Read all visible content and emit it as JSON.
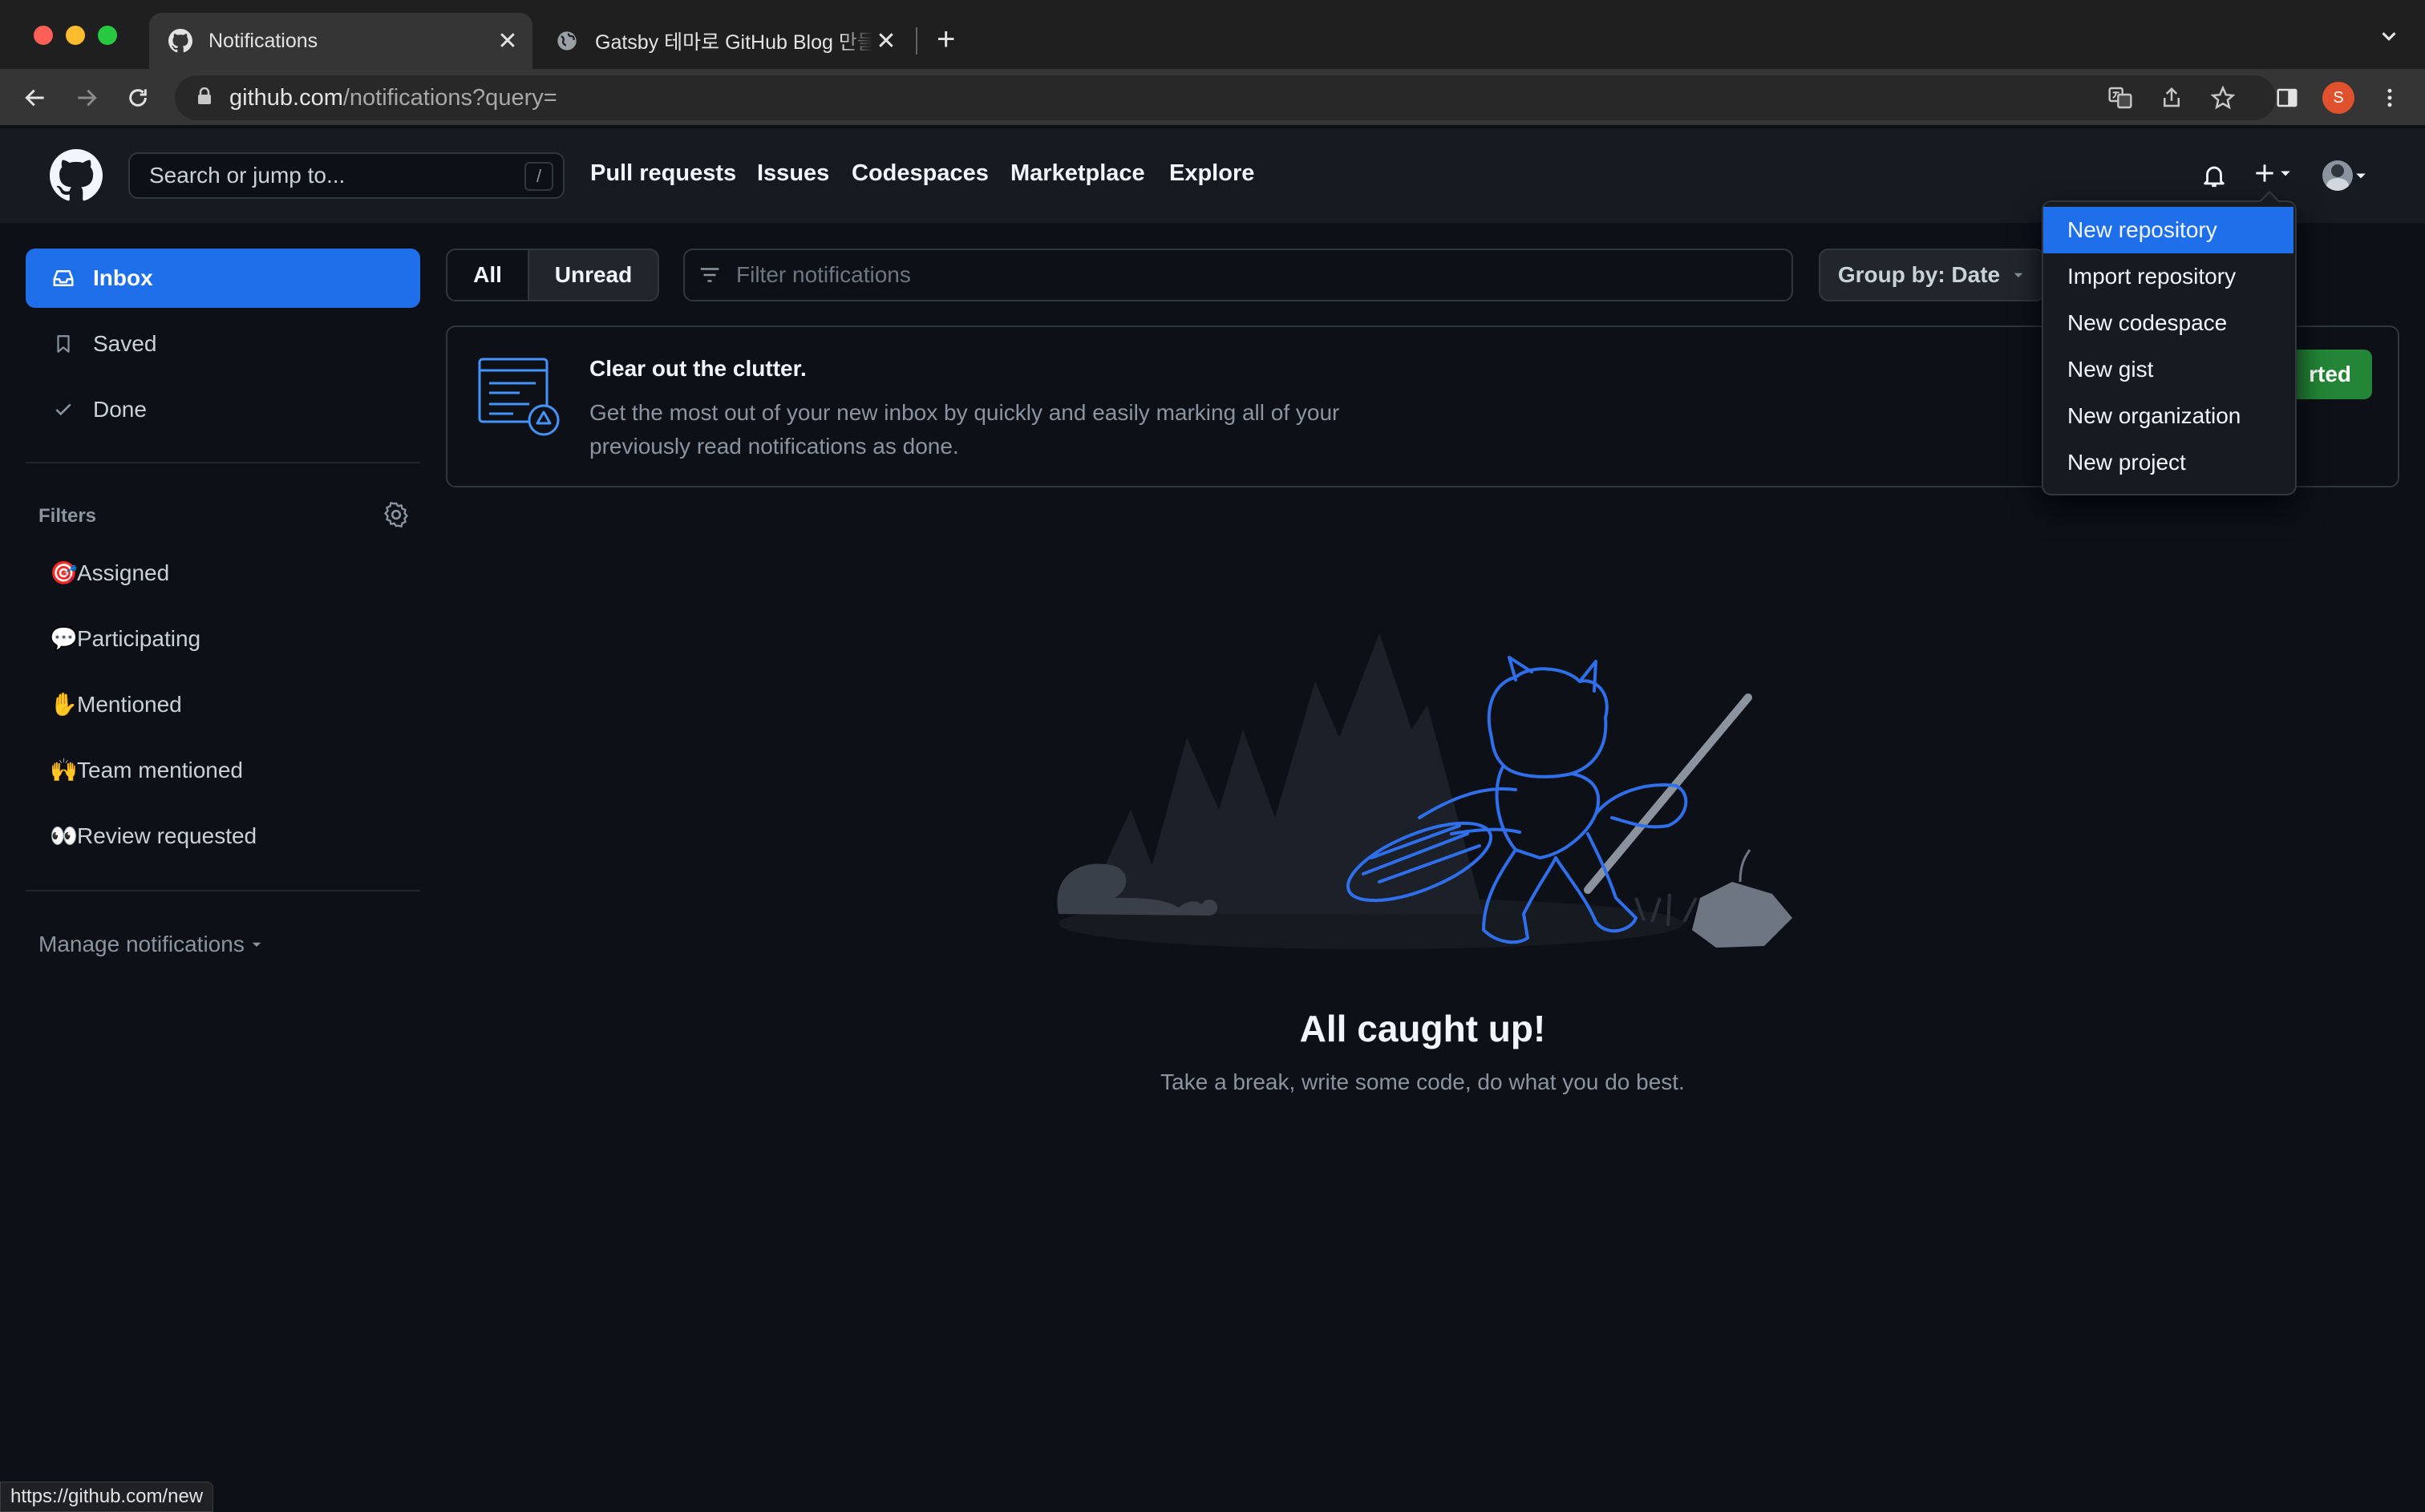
{
  "browser": {
    "tabs": [
      {
        "title": "Notifications",
        "active": true,
        "icon": "github-icon"
      },
      {
        "title": "Gatsby 테마로 GitHub Blog 만들기",
        "active": false,
        "icon": "globe-icon"
      }
    ],
    "new_tab_label": "+",
    "url_host": "github.com",
    "url_path": "/notifications?query=",
    "profile_initial": "S",
    "status_url": "https://github.com/new"
  },
  "header": {
    "search_placeholder": "Search or jump to...",
    "search_shortcut": "/",
    "nav": [
      "Pull requests",
      "Issues",
      "Codespaces",
      "Marketplace",
      "Explore"
    ]
  },
  "create_menu": {
    "items": [
      "New repository",
      "Import repository",
      "New codespace",
      "New gist",
      "New organization",
      "New project"
    ],
    "selected_index": 0
  },
  "sidebar": {
    "items": [
      {
        "label": "Inbox",
        "icon": "inbox-icon",
        "active": true
      },
      {
        "label": "Saved",
        "icon": "bookmark-icon",
        "active": false
      },
      {
        "label": "Done",
        "icon": "check-icon",
        "active": false
      }
    ],
    "filters_title": "Filters",
    "filters": [
      {
        "emoji": "🎯",
        "label": "Assigned"
      },
      {
        "emoji": "💬",
        "label": "Participating"
      },
      {
        "emoji": "✋",
        "label": "Mentioned"
      },
      {
        "emoji": "🙌",
        "label": "Team mentioned"
      },
      {
        "emoji": "👀",
        "label": "Review requested"
      }
    ],
    "manage_label": "Manage notifications"
  },
  "main": {
    "seg_all": "All",
    "seg_unread": "Unread",
    "filter_placeholder": "Filter notifications",
    "group_by_label": "Group by: Date",
    "banner": {
      "title": "Clear out the clutter.",
      "line1": "Get the most out of your new inbox by quickly and easily marking all of your",
      "line2": "previously read notifications as done.",
      "button_partial": "rted"
    },
    "empty_title": "All caught up!",
    "empty_subtitle": "Take a break, write some code, do what you do best."
  },
  "colors": {
    "accent_blue": "#1f6feb",
    "green_button": "#238636",
    "bg": "#0d1117",
    "header_bg": "#161b22"
  }
}
